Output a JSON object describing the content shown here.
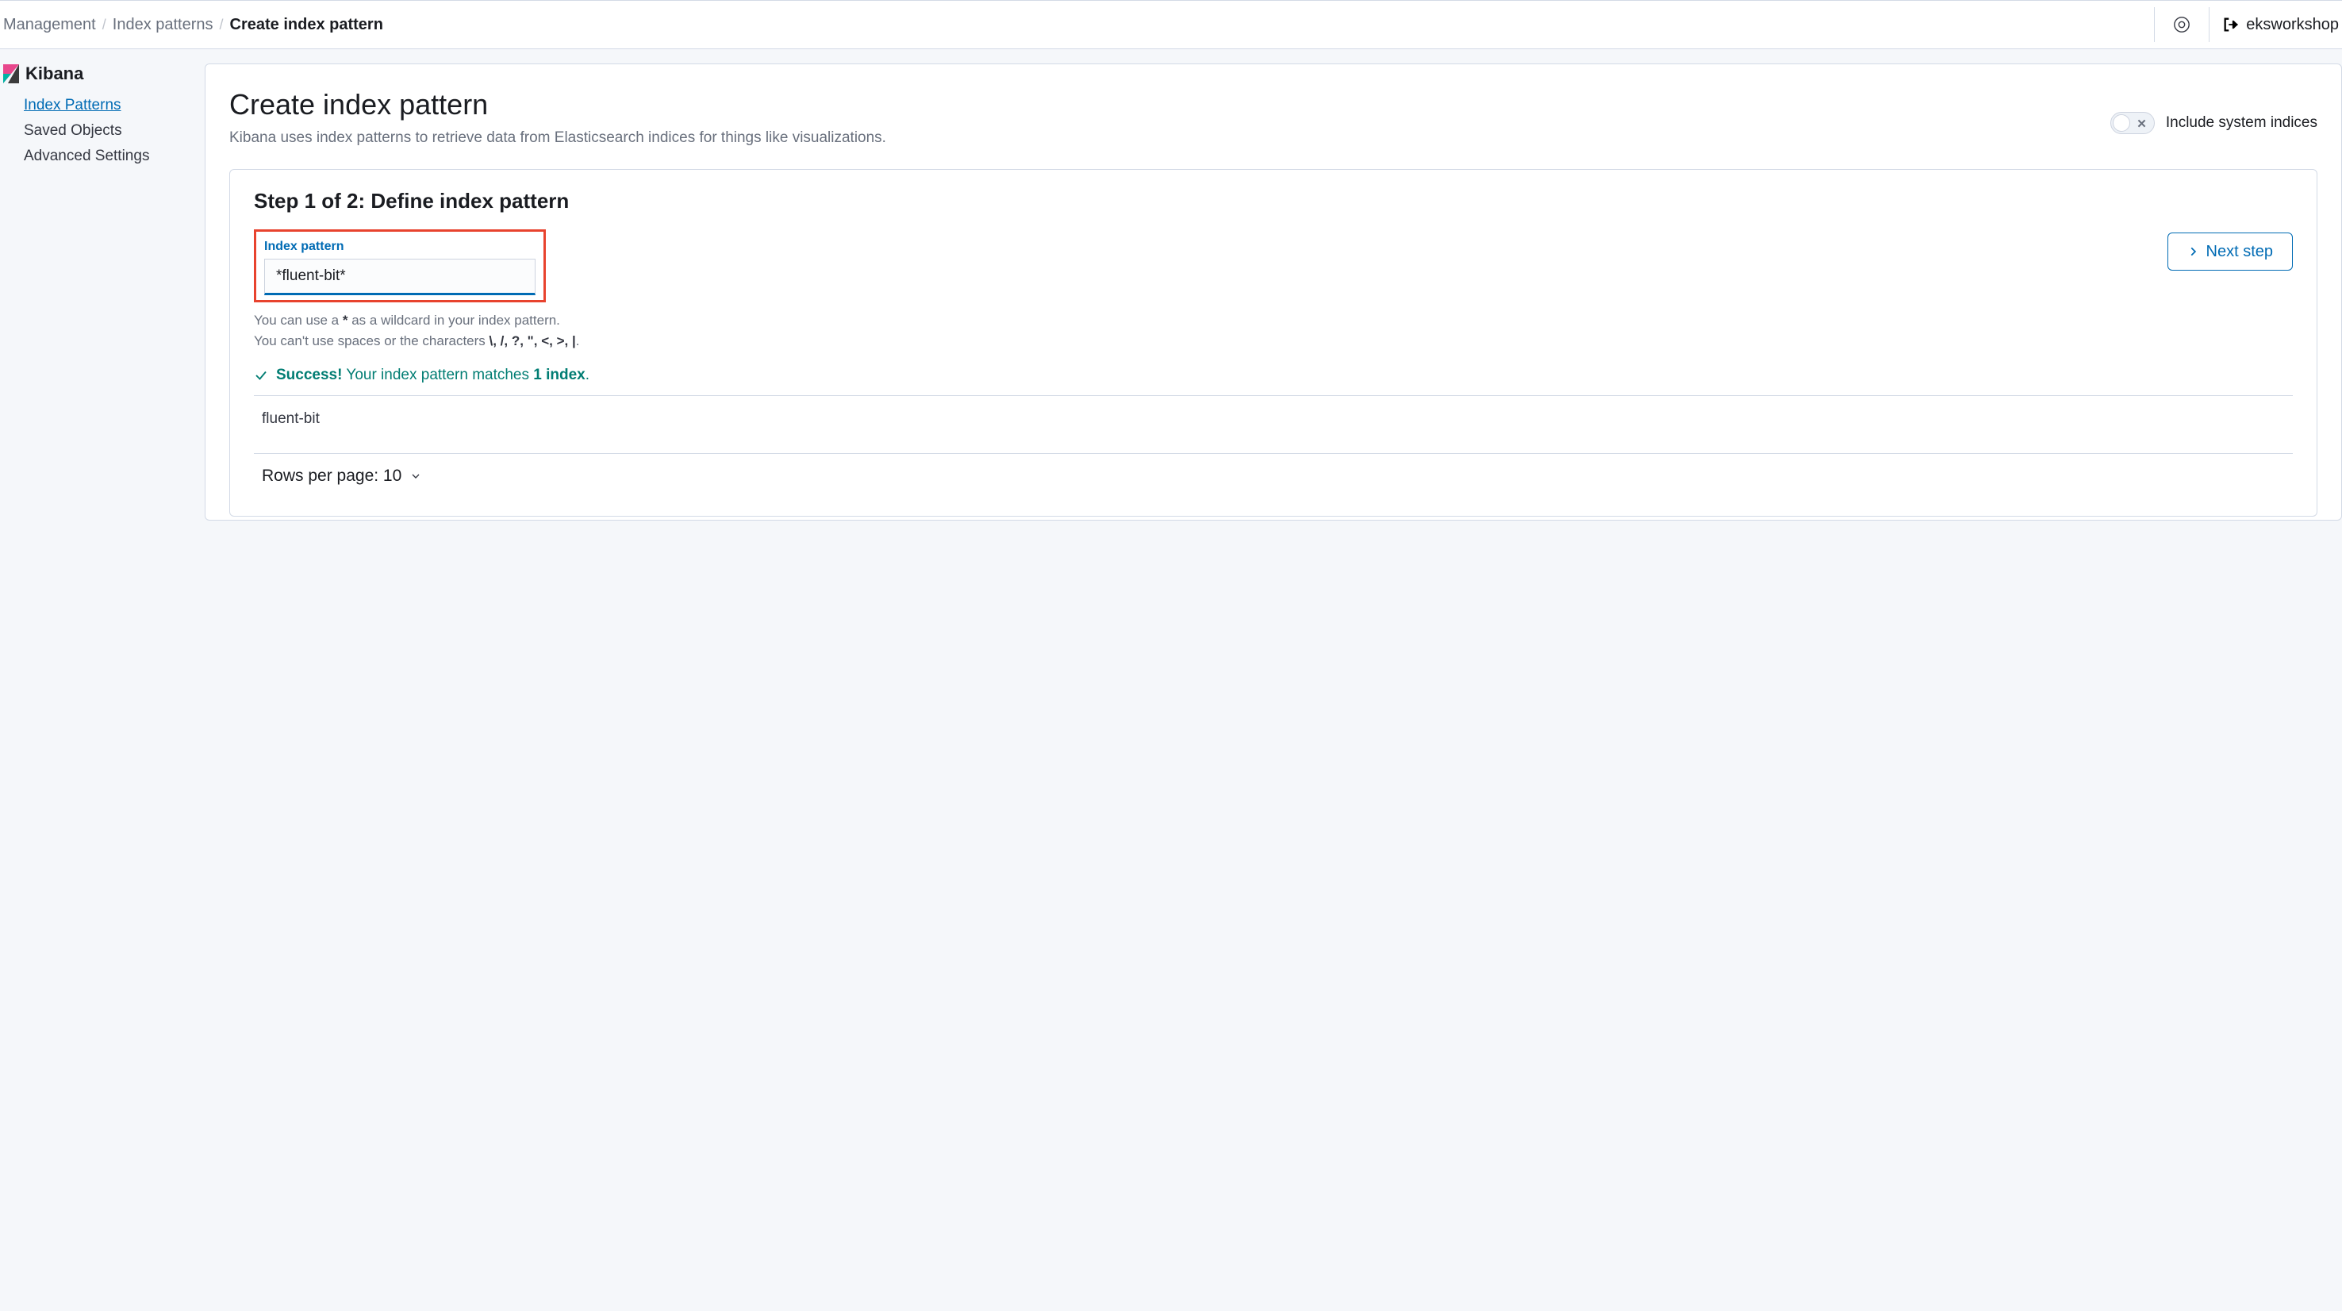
{
  "breadcrumbs": {
    "items": [
      "Management",
      "Index patterns",
      "Create index pattern"
    ]
  },
  "top_right": {
    "workspace_label": "eksworkshop"
  },
  "sidebar": {
    "title": "Kibana",
    "items": [
      {
        "label": "Index Patterns",
        "active": true
      },
      {
        "label": "Saved Objects",
        "active": false
      },
      {
        "label": "Advanced Settings",
        "active": false
      }
    ]
  },
  "page": {
    "title": "Create index pattern",
    "subtitle": "Kibana uses index patterns to retrieve data from Elasticsearch indices for things like visualizations.",
    "toggle_label": "Include system indices"
  },
  "step": {
    "title": "Step 1 of 2: Define index pattern",
    "field_label": "Index pattern",
    "field_value": "*fluent-bit*",
    "help_line_1_pre": "You can use a ",
    "help_line_1_star": "*",
    "help_line_1_post": " as a wildcard in your index pattern.",
    "help_line_2_pre": "You can't use spaces or the characters ",
    "help_line_2_chars": "\\, /, ?, \", <, >, |",
    "help_line_2_post": ".",
    "next_button": "Next step",
    "success_prefix": "Success!",
    "success_mid": " Your index pattern matches ",
    "success_count": "1 index",
    "success_suffix": ".",
    "matches": [
      "fluent-bit"
    ],
    "rows_per_page_label": "Rows per page: 10"
  }
}
